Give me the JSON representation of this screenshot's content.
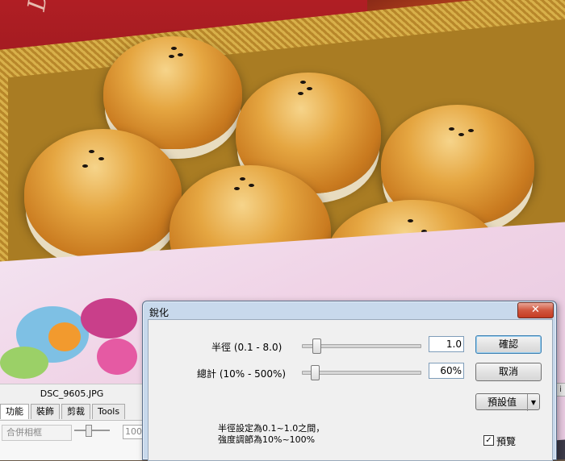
{
  "app": {
    "filename": "DSC_9605.JPG",
    "tabs": [
      {
        "label": "功能"
      },
      {
        "label": "裝飾"
      },
      {
        "label": "剪裁"
      },
      {
        "label": "Tools"
      }
    ],
    "merge_button": "合併相框",
    "mini_input_value": "100",
    "right_edge_glyph": "i"
  },
  "photo": {
    "script_text": "Delicio"
  },
  "dialog": {
    "title": "銳化",
    "close_glyph": "✕",
    "radius": {
      "label": "半徑 (0.1 - 8.0)",
      "value": "1.0",
      "slider_fraction": 0.114
    },
    "amount": {
      "label": "總計 (10% - 500%)",
      "value": "60%",
      "slider_fraction": 0.102
    },
    "ok_label": "確認",
    "cancel_label": "取消",
    "preset_label": "預設值",
    "preset_arrow": "▼",
    "note_line1": "半徑設定為0.1~1.0之間，",
    "note_line2": "強度調節為10%~100%",
    "preview_label": "預覽",
    "preview_checked": true
  },
  "colors": {
    "dialog_frame": "#c8d9ec",
    "close_red": "#c43b22"
  }
}
